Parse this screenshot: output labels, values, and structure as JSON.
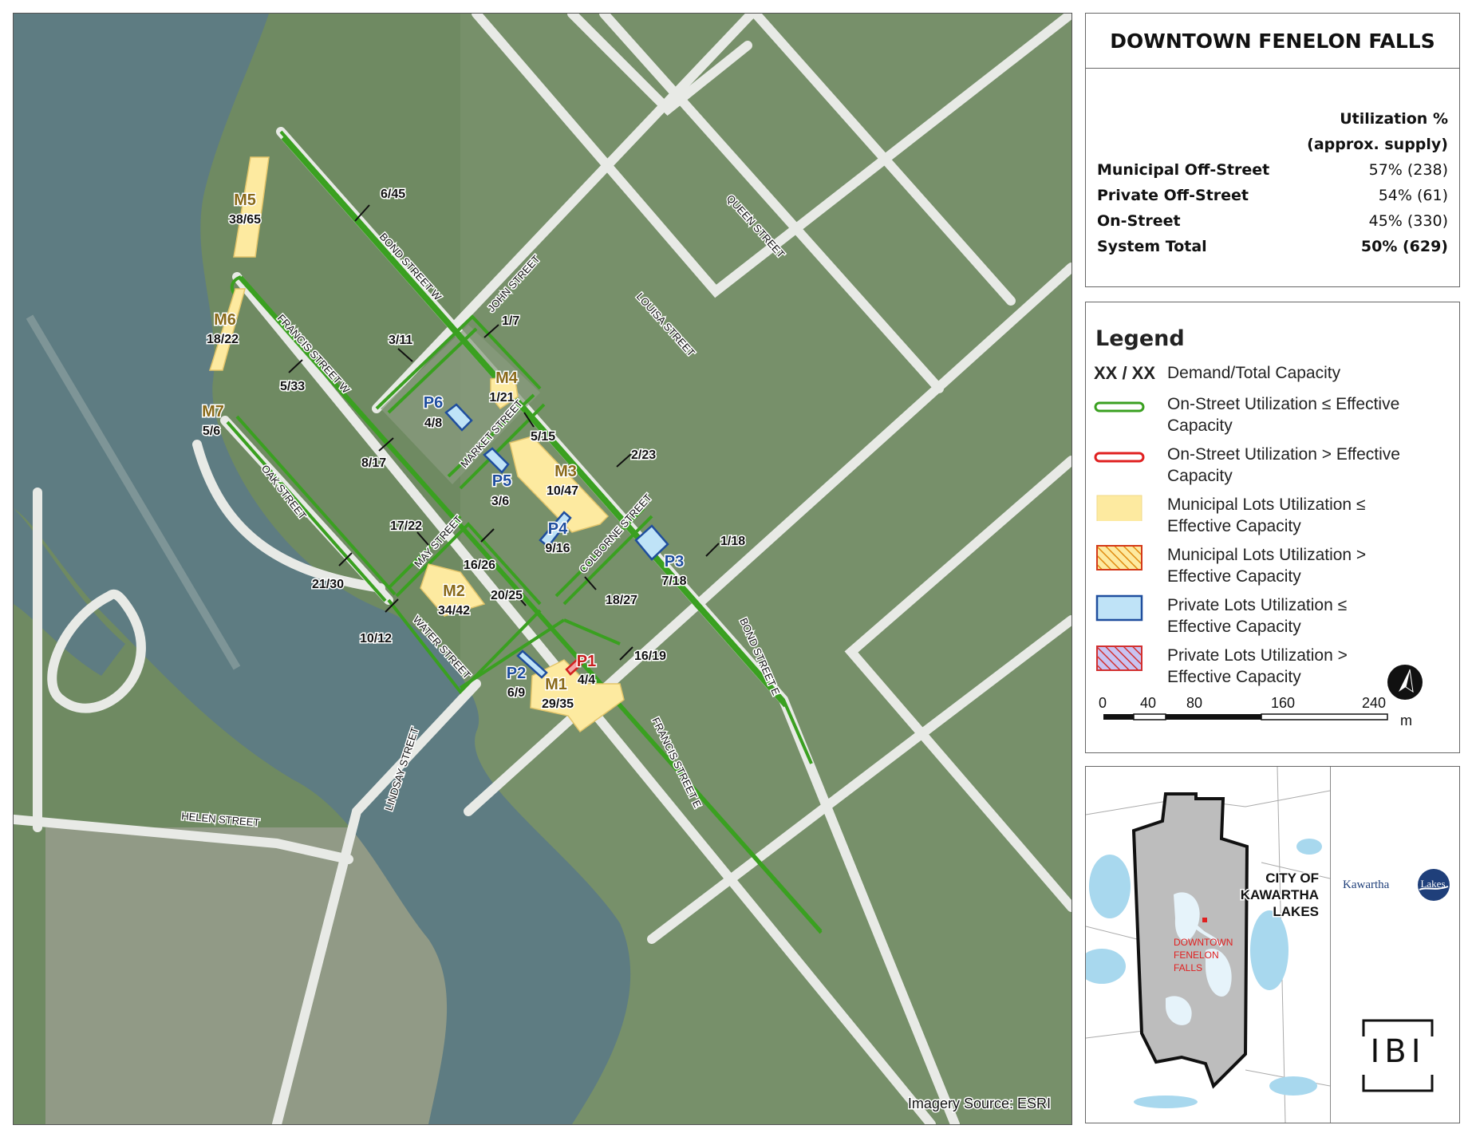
{
  "title": "DOWNTOWN FENELON FALLS",
  "utilization": {
    "header_line1": "Utilization %",
    "header_line2": "(approx. supply)",
    "rows": [
      {
        "label": "Municipal Off-Street",
        "value": "57% (238)"
      },
      {
        "label": "Private Off-Street",
        "value": "54% (61)"
      },
      {
        "label": "On-Street",
        "value": "45% (330)"
      },
      {
        "label": "System Total",
        "value": "50% (629)"
      }
    ]
  },
  "legend": {
    "title": "Legend",
    "xx_symbol": "XX / XX",
    "items": [
      {
        "key": "xx",
        "line1": "Demand/Total Capacity",
        "line2": ""
      },
      {
        "key": "onstreet_ok",
        "line1": "On-Street Utilization ≤ Effective",
        "line2": "Capacity",
        "color": "#3aa020"
      },
      {
        "key": "onstreet_over",
        "line1": "On-Street Utilization > Effective",
        "line2": "Capacity",
        "color": "#e02020"
      },
      {
        "key": "muni_ok",
        "line1": "Municipal Lots Utilization ≤",
        "line2": "Effective Capacity",
        "color": "#fdeaa0"
      },
      {
        "key": "muni_over",
        "line1": "Municipal Lots Utilization >",
        "line2": "Effective Capacity",
        "color": "#f0a020"
      },
      {
        "key": "priv_ok",
        "line1": "Private Lots Utilization ≤",
        "line2": "Effective Capacity",
        "color": "#bfe3f7"
      },
      {
        "key": "priv_over",
        "line1": "Private Lots Utilization >",
        "line2": "Effective Capacity",
        "color": "#d23030"
      }
    ]
  },
  "scale": {
    "ticks": [
      "0",
      "40",
      "80",
      "160",
      "240"
    ],
    "unit": "m"
  },
  "imagery_source": "Imagery Source: ESRI",
  "streets": [
    {
      "id": "bond-w",
      "name": "BOND STREET W"
    },
    {
      "id": "john",
      "name": "JOHN STREET"
    },
    {
      "id": "queen",
      "name": "QUEEN STREET"
    },
    {
      "id": "louisa",
      "name": "LOUISA STREET"
    },
    {
      "id": "francis-w",
      "name": "FRANCIS STREET W"
    },
    {
      "id": "market",
      "name": "MARKET STREET"
    },
    {
      "id": "oak",
      "name": "OAK STREET"
    },
    {
      "id": "may",
      "name": "MAY STREET"
    },
    {
      "id": "colborne",
      "name": "COLBORNE STREET"
    },
    {
      "id": "water",
      "name": "WATER STREET"
    },
    {
      "id": "bond-e",
      "name": "BOND STREET E"
    },
    {
      "id": "lindsay",
      "name": "LINDSAY STREET"
    },
    {
      "id": "francis-e",
      "name": "FRANCIS STREET E"
    },
    {
      "id": "helen",
      "name": "HELEN STREET"
    }
  ],
  "lots": [
    {
      "id": "M1",
      "value": "29/35",
      "type": "municipal"
    },
    {
      "id": "M2",
      "value": "34/42",
      "type": "municipal"
    },
    {
      "id": "M3",
      "value": "10/47",
      "type": "municipal"
    },
    {
      "id": "M4",
      "value": "1/21",
      "type": "municipal"
    },
    {
      "id": "M5",
      "value": "38/65",
      "type": "municipal"
    },
    {
      "id": "M6",
      "value": "18/22",
      "type": "municipal"
    },
    {
      "id": "M7",
      "value": "5/6",
      "type": "municipal"
    },
    {
      "id": "P1",
      "value": "4/4",
      "type": "private_over"
    },
    {
      "id": "P2",
      "value": "6/9",
      "type": "private"
    },
    {
      "id": "P3",
      "value": "7/18",
      "type": "private"
    },
    {
      "id": "P4",
      "value": "9/16",
      "type": "private"
    },
    {
      "id": "P5",
      "value": "3/6",
      "type": "private"
    },
    {
      "id": "P6",
      "value": "4/8",
      "type": "private"
    }
  ],
  "segments": [
    "6/45",
    "1/7",
    "3/11",
    "5/33",
    "8/17",
    "5/15",
    "2/23",
    "17/22",
    "16/26",
    "21/30",
    "20/25",
    "10/12",
    "1/18",
    "18/27",
    "16/19"
  ],
  "inset": {
    "city_label": [
      "CITY OF",
      "KAWARTHA",
      "LAKES"
    ],
    "town_label": [
      "DOWNTOWN",
      "FENELON",
      "FALLS"
    ],
    "logo_text": "Kawartha",
    "logo_circle_text": "Lakes",
    "ibi": "IBI"
  },
  "colors": {
    "onstreet_ok": "#3aa020",
    "onstreet_over": "#e02020",
    "municipal": "#fdeaa0",
    "private": "#bfe3f7",
    "private_outline": "#1f4e9e",
    "water": "#5e7c82",
    "land": "#6f8a62",
    "road": "#e8eae6"
  }
}
